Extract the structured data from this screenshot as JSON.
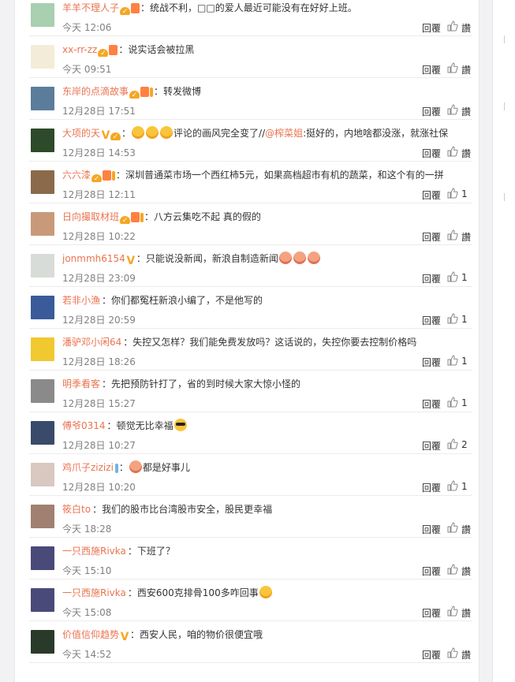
{
  "actions": {
    "reply_label": "回覆",
    "like_label": "讚"
  },
  "comments": [
    {
      "user": "羊羊不理人子",
      "text": "统战不利，□□的爱人最近可能没有在好好上班。",
      "time": "今天 12:06",
      "like": "讚",
      "badges": [
        "vip"
      ],
      "avatar_color": "#a8cfb0"
    },
    {
      "user": "xx-rr-zz",
      "text": "说实话会被拉黑",
      "time": "今天 09:51",
      "like": "讚",
      "badges": [
        "vip"
      ],
      "avatar_color": "#f3ecd8"
    },
    {
      "user": "东岸的点滴故事",
      "text": "转发微博",
      "time": "12月28日 17:51",
      "like": "讚",
      "badges": [
        "vip",
        "铁粉"
      ],
      "avatar_color": "#5c7c9c"
    },
    {
      "user": "大项的天",
      "text": "评论的画风完全变了//",
      "mention": "@榨菜姐",
      "text2": ":挺好的，内地啥都没涨，就涨社保",
      "time": "12月28日 14:53",
      "like": "讚",
      "badges": [
        "v",
        "lvl"
      ],
      "emoji": [
        "laugh",
        "laugh",
        "laugh"
      ],
      "avatar_color": "#2d4a2a"
    },
    {
      "user": "六六漆",
      "text": "深圳普通菜市场一个西红柿5元，如果高档超市有机的蔬菜，和这个有的一拼",
      "time": "12月28日 12:11",
      "like": "1",
      "badges": [
        "vip",
        "铁粉"
      ],
      "avatar_color": "#8a6a4a"
    },
    {
      "user": "日向撮取材班",
      "text": "八方云集吃不起 真的假的",
      "time": "12月28日 10:22",
      "like": "讚",
      "badges": [
        "vip",
        "铁粉"
      ],
      "avatar_color": "#c89a7a"
    },
    {
      "user": "jonmmh6154",
      "text": "只能说没新闻，新浪自制造新闻",
      "time": "12月28日 23:09",
      "like": "1",
      "badges": [
        "v"
      ],
      "emoji_after": [
        "cry",
        "cry",
        "cry"
      ],
      "avatar_color": "#d8dcd8"
    },
    {
      "user": "若非小漁",
      "text": "你们都冤枉新浪小编了，不是他写的",
      "time": "12月28日 20:59",
      "like": "1",
      "badges": [],
      "avatar_color": "#3a5a9a"
    },
    {
      "user": "潘驴邓小闲64",
      "text": "失控又怎样？我们能免费发放吗？这话说的，失控你要去控制价格吗",
      "time": "12月28日 18:26",
      "like": "1",
      "badges": [],
      "avatar_color": "#f0c830"
    },
    {
      "user": "明季看客",
      "text": "先把预防针打了，省的到时候大家大惊小怪的",
      "time": "12月28日 15:27",
      "like": "1",
      "badges": [],
      "avatar_color": "#8a8a8a"
    },
    {
      "user": "傅爷0314",
      "text": "顿觉无比幸福",
      "time": "12月28日 10:27",
      "like": "2",
      "badges": [],
      "emoji_after": [
        "cool"
      ],
      "avatar_color": "#3a4a6a"
    },
    {
      "user": "鸡爪子zizizi",
      "text": "都是好事儿",
      "time": "12月28日 10:20",
      "like": "1",
      "badges": [
        "铁粉blue"
      ],
      "emoji_before": [
        "cry"
      ],
      "avatar_color": "#d8c8c0"
    },
    {
      "user": "筱白to",
      "text": "我们的股市比台湾股市安全，股民更幸福",
      "time": "今天 18:28",
      "like": "讚",
      "badges": [],
      "avatar_color": "#a08070"
    },
    {
      "user": "一只西施Rivka",
      "text": "下班了？",
      "time": "今天 15:10",
      "like": "讚",
      "badges": [],
      "avatar_color": "#4a4a7a"
    },
    {
      "user": "一只西施Rivka",
      "text": "西安600克排骨100多咋回事",
      "time": "今天 15:08",
      "like": "讚",
      "badges": [],
      "emoji_after": [
        "laugh"
      ],
      "avatar_color": "#4a4a7a"
    },
    {
      "user": "价值信仰趋势",
      "text": "西安人民，咱的物价很便宜哦",
      "time": "今天 14:52",
      "like": "讚",
      "badges": [
        "v"
      ],
      "avatar_color": "#2a3a2a"
    }
  ]
}
